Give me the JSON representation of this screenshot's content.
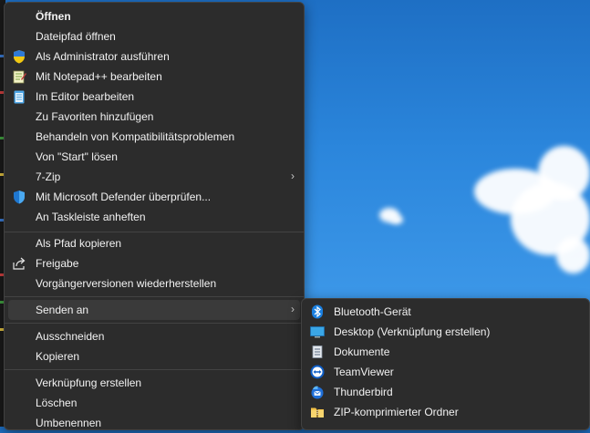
{
  "context_menu": {
    "items": [
      {
        "label": "Öffnen",
        "icon": null
      },
      {
        "label": "Dateipfad öffnen",
        "icon": null
      },
      {
        "label": "Als Administrator ausführen",
        "icon": "uac-shield-icon"
      },
      {
        "label": "Mit Notepad++ bearbeiten",
        "icon": "notepadpp-icon"
      },
      {
        "label": "Im Editor bearbeiten",
        "icon": "notepad-icon"
      },
      {
        "label": "Zu Favoriten hinzufügen",
        "icon": null
      },
      {
        "label": "Behandeln von Kompatibilitätsproblemen",
        "icon": null
      },
      {
        "label": "Von \"Start\" lösen",
        "icon": null
      },
      {
        "label": "7-Zip",
        "icon": null,
        "submenu": true
      },
      {
        "label": "Mit Microsoft Defender überprüfen...",
        "icon": "defender-icon"
      },
      {
        "label": "An Taskleiste anheften",
        "icon": null
      },
      {
        "label": "Als Pfad kopieren",
        "icon": null
      },
      {
        "label": "Freigabe",
        "icon": "share-icon"
      },
      {
        "label": "Vorgängerversionen wiederherstellen",
        "icon": null
      },
      {
        "label": "Senden an",
        "icon": null,
        "submenu": true,
        "highlighted": true
      },
      {
        "label": "Ausschneiden",
        "icon": null
      },
      {
        "label": "Kopieren",
        "icon": null
      },
      {
        "label": "Verknüpfung erstellen",
        "icon": null
      },
      {
        "label": "Löschen",
        "icon": null
      },
      {
        "label": "Umbenennen",
        "icon": null
      }
    ]
  },
  "send_to_submenu": {
    "items": [
      {
        "label": "Bluetooth-Gerät",
        "icon": "bluetooth-icon"
      },
      {
        "label": "Desktop (Verknüpfung erstellen)",
        "icon": "desktop-icon"
      },
      {
        "label": "Dokumente",
        "icon": "documents-icon"
      },
      {
        "label": "TeamViewer",
        "icon": "teamviewer-icon"
      },
      {
        "label": "Thunderbird",
        "icon": "thunderbird-icon"
      },
      {
        "label": "ZIP-komprimierter Ordner",
        "icon": "zip-folder-icon"
      }
    ]
  },
  "colors": {
    "menu_background": "#2c2c2c",
    "hover_background": "#3a3a3a",
    "text": "#f2f2f2",
    "desktop_sky": "#2b86dc"
  }
}
